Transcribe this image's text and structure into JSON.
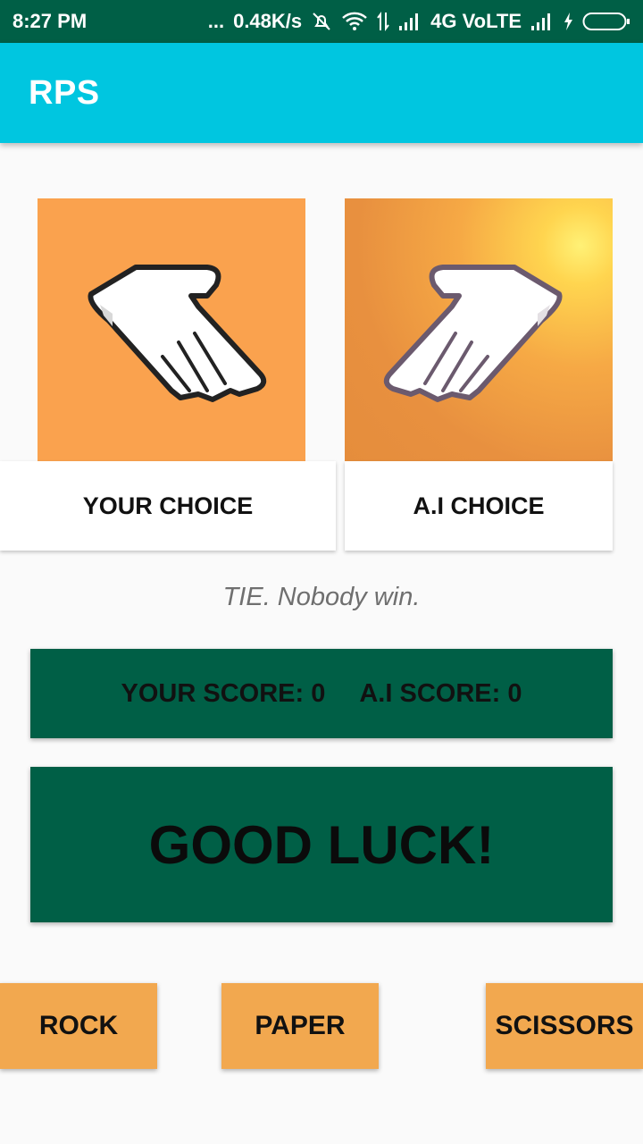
{
  "status_bar": {
    "time": "8:27 PM",
    "dots": "...",
    "net_speed": "0.48K/s",
    "network": "4G VoLTE"
  },
  "app_bar": {
    "title": "RPS"
  },
  "choices": {
    "user": {
      "label": "YOUR CHOICE",
      "icon": "paper-hand-icon"
    },
    "ai": {
      "label": "A.I CHOICE",
      "icon": "paper-hand-icon"
    }
  },
  "result": {
    "text": "TIE. Nobody win."
  },
  "score": {
    "user": "YOUR SCORE: 0",
    "ai": "A.I SCORE: 0"
  },
  "message": "GOOD LUCK!",
  "buttons": {
    "rock": "ROCK",
    "paper": "PAPER",
    "scissors": "SCISSORS"
  },
  "colors": {
    "status_bar": "#005f46",
    "app_bar": "#00c6e0",
    "user_card": "#faa24e",
    "score_bg": "#005f46",
    "button_bg": "#f2a84f"
  }
}
